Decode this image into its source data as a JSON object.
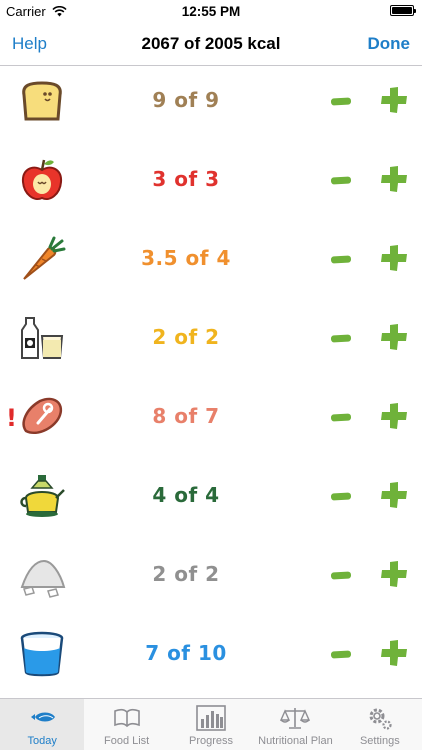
{
  "status_bar": {
    "carrier": "Carrier",
    "time": "12:55 PM"
  },
  "nav": {
    "help": "Help",
    "title": "2067 of 2005 kcal",
    "done": "Done"
  },
  "foods": [
    {
      "icon": "bread-icon",
      "count": "9 of 9",
      "color": "#a08055",
      "warning": ""
    },
    {
      "icon": "apple-icon",
      "count": "3 of 3",
      "color": "#e0322e",
      "warning": ""
    },
    {
      "icon": "carrot-icon",
      "count": "3.5 of 4",
      "color": "#f0902e",
      "warning": ""
    },
    {
      "icon": "milk-icon",
      "count": "2 of 2",
      "color": "#f0b41e",
      "warning": ""
    },
    {
      "icon": "meat-icon",
      "count": "8 of 7",
      "color": "#e8806a",
      "warning": "!"
    },
    {
      "icon": "oil-icon",
      "count": "4 of 4",
      "color": "#2a6a3a",
      "warning": ""
    },
    {
      "icon": "sugar-icon",
      "count": "2 of 2",
      "color": "#909090",
      "warning": ""
    },
    {
      "icon": "water-icon",
      "count": "7 of 10",
      "color": "#2a90e0",
      "warning": ""
    }
  ],
  "tabs": [
    {
      "label": "Today",
      "icon": "fish-icon"
    },
    {
      "label": "Food List",
      "icon": "book-icon"
    },
    {
      "label": "Progress",
      "icon": "bar-chart-icon"
    },
    {
      "label": "Nutritional Plan",
      "icon": "scale-icon"
    },
    {
      "label": "Settings",
      "icon": "gear-icon"
    }
  ],
  "colors": {
    "accent": "#1e7ec8",
    "button_green": "#6fb23a"
  }
}
